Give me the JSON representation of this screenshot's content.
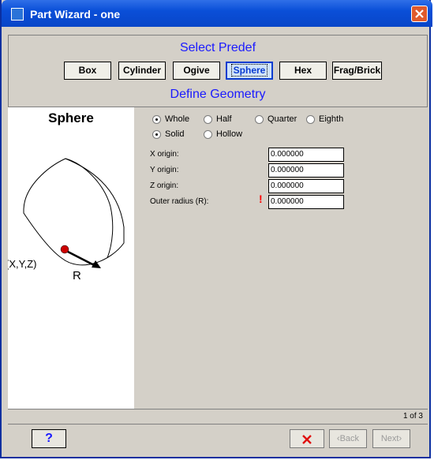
{
  "window": {
    "title": "Part Wizard - one",
    "icon": "wizard-app-icon",
    "close_icon": "close-icon"
  },
  "header": {
    "select_title": "Select Predef",
    "predefs": [
      {
        "label": "Box",
        "active": false
      },
      {
        "label": "Cylinder",
        "active": false
      },
      {
        "label": "Ogive",
        "active": false
      },
      {
        "label": "Sphere",
        "active": true
      },
      {
        "label": "Hex",
        "active": false
      },
      {
        "label": "Frag/Brick",
        "active": false
      }
    ],
    "geometry_title": "Define Geometry"
  },
  "diagram": {
    "shape_title": "Sphere",
    "point_label": "(X,Y,Z)",
    "radius_label": "R",
    "point_color": "#cc0000"
  },
  "options": {
    "portion": [
      {
        "label": "Whole",
        "selected": true
      },
      {
        "label": "Half",
        "selected": false
      },
      {
        "label": "Quarter",
        "selected": false
      },
      {
        "label": "Eighth",
        "selected": false
      }
    ],
    "fill": [
      {
        "label": "Solid",
        "selected": true
      },
      {
        "label": "Hollow",
        "selected": false
      }
    ]
  },
  "fields": [
    {
      "label": "X origin:",
      "value": "0.000000",
      "required": false
    },
    {
      "label": "Y origin:",
      "value": "0.000000",
      "required": false
    },
    {
      "label": "Z origin:",
      "value": "0.000000",
      "required": false
    },
    {
      "label": "Outer radius (R):",
      "value": "0.000000",
      "required": true
    }
  ],
  "required_marker": "!",
  "status": {
    "page": "1 of 3"
  },
  "footer": {
    "help_label": "?",
    "cancel_icon": "cancel-x-icon",
    "back_label": "Back",
    "next_label": "Next"
  },
  "colors": {
    "title_blue": "#0a4fd8",
    "link_blue": "#1a1aff",
    "warning_red": "#ff0000",
    "panel_gray": "#d4d0c8"
  }
}
